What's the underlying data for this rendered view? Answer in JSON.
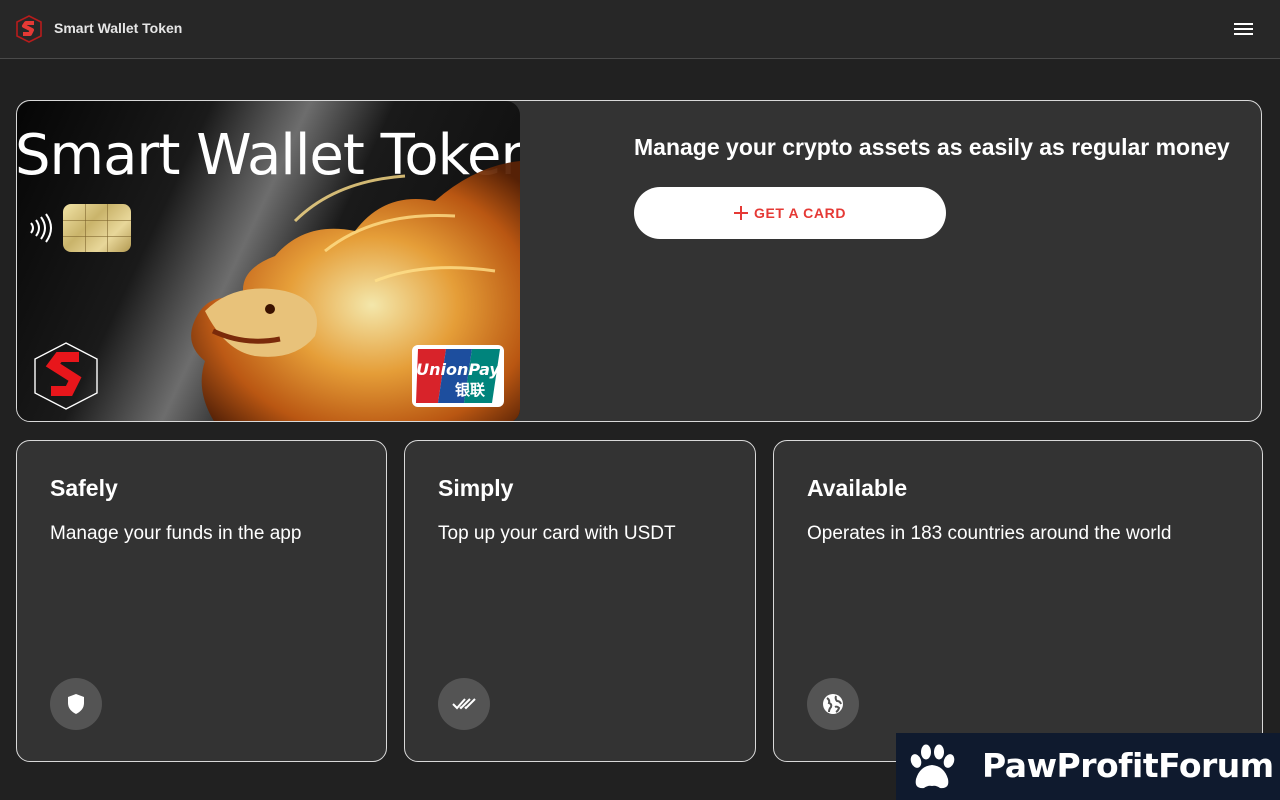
{
  "header": {
    "app_title": "Smart Wallet Token",
    "logo_icon": "smart-wallet-logo",
    "menu_icon": "hamburger-menu-icon"
  },
  "hero": {
    "card_brand_text": "Smart Wallet Token",
    "card_network_text": "UnionPay",
    "card_network_chinese": "银联",
    "title": "Manage your crypto assets as easily as regular money",
    "cta_label": "GET A CARD",
    "cta_icon": "plus-icon"
  },
  "features": [
    {
      "title": "Safely",
      "text": "Manage your funds in the app",
      "icon": "shield-icon"
    },
    {
      "title": "Simply",
      "text": "Top up your card with USDT",
      "icon": "double-check-icon"
    },
    {
      "title": "Available",
      "text": "Operates in 183 countries around the world",
      "icon": "globe-icon"
    }
  ],
  "watermark": {
    "text": "PawProfitForum",
    "icon": "paw-icon"
  },
  "colors": {
    "background": "#212121",
    "panel": "#333333",
    "header": "#272727",
    "accent_red": "#e53935",
    "icon_circle": "#545454",
    "watermark_bg": "#0f1a2e"
  }
}
